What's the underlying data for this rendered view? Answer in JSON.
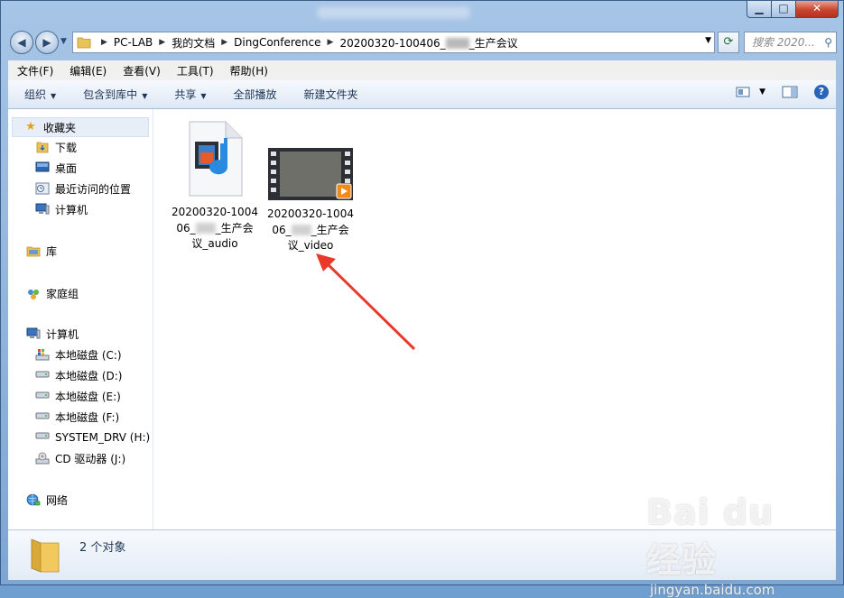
{
  "window": {
    "min_label": "▁",
    "max_label": "□",
    "close_label": "✕"
  },
  "address": {
    "segments": [
      "PC-LAB",
      "我的文档",
      "DingConference"
    ],
    "last_prefix": "20200320-100406_",
    "last_suffix": "_生产会议",
    "search_placeholder": "搜索 2020..."
  },
  "menu": [
    "文件(F)",
    "编辑(E)",
    "查看(V)",
    "工具(T)",
    "帮助(H)"
  ],
  "commands": {
    "organize": "组织",
    "include_library": "包含到库中",
    "share": "共享",
    "play_all": "全部播放",
    "new_folder": "新建文件夹"
  },
  "nav": {
    "favorites": "收藏夹",
    "downloads": "下载",
    "desktop": "桌面",
    "recent": "最近访问的位置",
    "computer_fav": "计算机",
    "libraries": "库",
    "homegroup": "家庭组",
    "computer": "计算机",
    "drives": [
      "本地磁盘 (C:)",
      "本地磁盘 (D:)",
      "本地磁盘 (E:)",
      "本地磁盘 (F:)",
      "SYSTEM_DRV (H:)",
      "CD 驱动器 (J:)"
    ],
    "network": "网络"
  },
  "files": [
    {
      "line1": "20200320-1004",
      "line2a": "06_",
      "line2b": "_生产会",
      "line3": "议_audio"
    },
    {
      "line1": "20200320-1004",
      "line2a": "06_",
      "line2b": "_生产会",
      "line3": "议_video"
    }
  ],
  "status": {
    "count": "2 个对象"
  },
  "watermark": {
    "brand": "Bai du 经验",
    "url": "jingyan.baidu.com"
  },
  "colors": {
    "arrow": "#e8392b",
    "accent": "#2a64b8"
  }
}
